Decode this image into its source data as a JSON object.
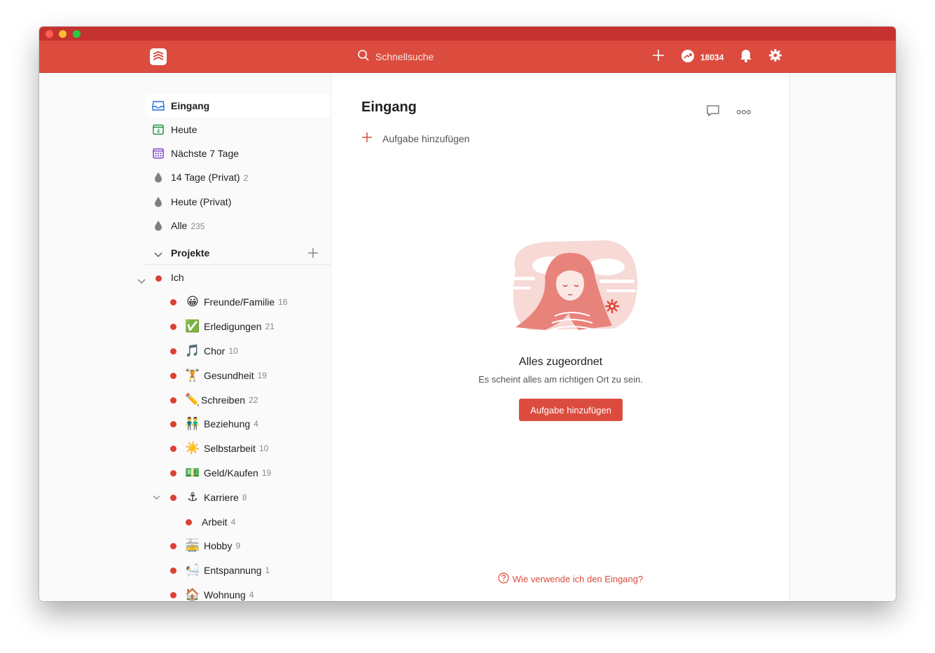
{
  "topbar": {
    "search_placeholder": "Schnellsuche",
    "karma_count": "18034",
    "icons": [
      "todoist-logo-icon",
      "search-icon",
      "plus-icon",
      "karma-icon",
      "bell-icon",
      "gear-icon"
    ],
    "accent_color": "#db4c3f"
  },
  "sidebar": {
    "filters": [
      {
        "label": "Eingang",
        "count": "",
        "icon": "inbox-icon"
      },
      {
        "label": "Heute",
        "count": "",
        "icon": "calendar-today-icon"
      },
      {
        "label": "Nächste 7 Tage",
        "count": "",
        "icon": "calendar-week-icon"
      },
      {
        "label": "14 Tage (Privat)",
        "count": "2",
        "icon": "filter-drop-icon"
      },
      {
        "label": "Heute (Privat)",
        "count": "",
        "icon": "filter-drop-icon"
      },
      {
        "label": "Alle",
        "count": "235",
        "icon": "filter-drop-icon"
      }
    ],
    "projects_header": "Projekte",
    "projects": [
      {
        "emoji": "",
        "label": "Ich",
        "count": ""
      },
      {
        "emoji": "😀",
        "label": "Freunde/Familie",
        "count": "16"
      },
      {
        "emoji": "✅",
        "label": "Erledigungen",
        "count": "21"
      },
      {
        "emoji": "🎵",
        "label": "Chor",
        "count": "10"
      },
      {
        "emoji": "🏋",
        "label": "Gesundheit",
        "count": "19"
      },
      {
        "emoji": "✏️",
        "label": "Schreiben",
        "count": "22"
      },
      {
        "emoji": "👬",
        "label": "Beziehung",
        "count": "4"
      },
      {
        "emoji": "☀️",
        "label": "Selbstarbeit",
        "count": "10"
      },
      {
        "emoji": "💵",
        "label": "Geld/Kaufen",
        "count": "19"
      },
      {
        "emoji": "⚓",
        "label": "Karriere",
        "count": "8"
      },
      {
        "emoji": "",
        "label": "Arbeit",
        "count": "4"
      },
      {
        "emoji": "🚋",
        "label": "Hobby",
        "count": "9"
      },
      {
        "emoji": "🛀",
        "label": "Entspannung",
        "count": "1"
      },
      {
        "emoji": "🏠",
        "label": "Wohnung",
        "count": "4"
      }
    ],
    "project_color": "#db4035"
  },
  "main": {
    "title": "Eingang",
    "add_task_label": "Aufgabe hinzufügen",
    "empty_title": "Alles zugeordnet",
    "empty_subtitle": "Es scheint alles am richtigen Ort zu sein.",
    "empty_button": "Aufgabe hinzufügen",
    "help_link": "Wie verwende ich den Eingang?"
  }
}
